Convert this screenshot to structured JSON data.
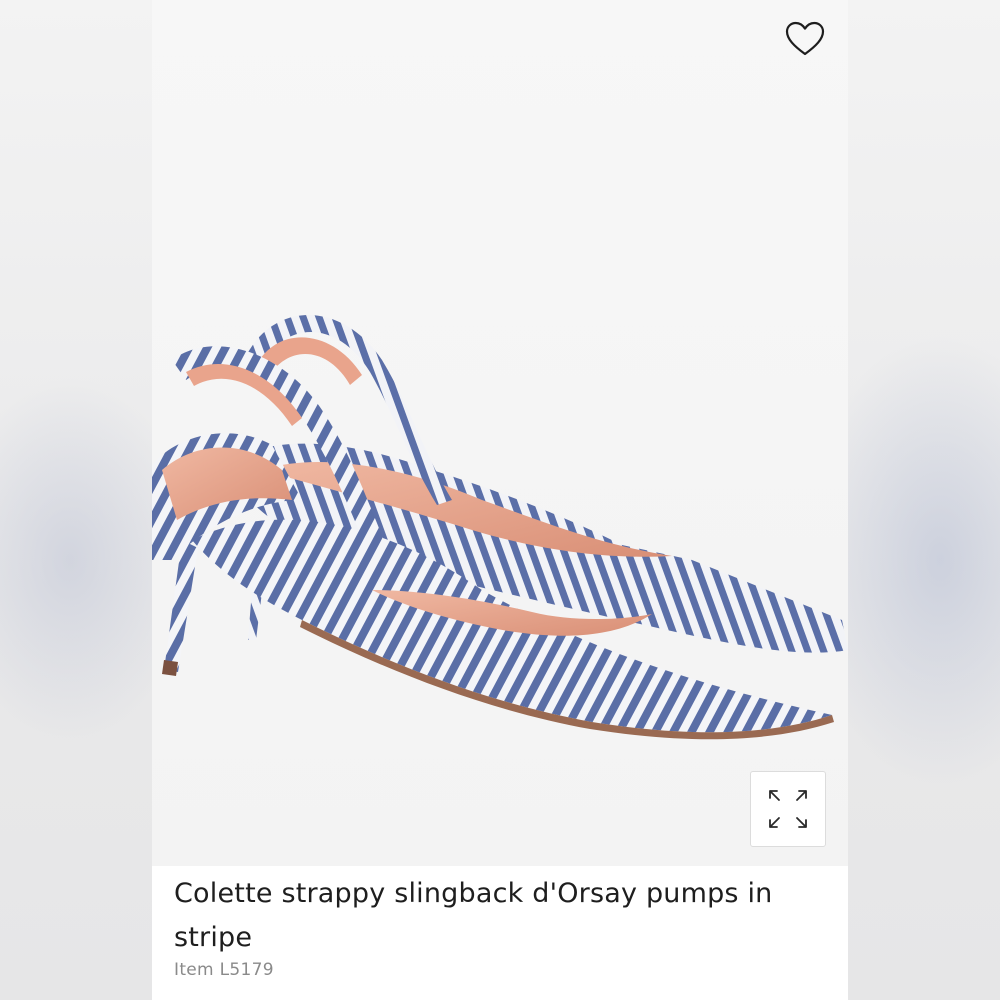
{
  "product": {
    "title": "Colette strappy slingback d'Orsay pumps in stripe",
    "item_number": "Item L5179",
    "image_alt": "Striped slingback kitten heel pumps"
  },
  "icons": {
    "favorite": "heart-icon",
    "expand": "expand-icon"
  },
  "colors": {
    "stripe_blue": "#5a6ea6",
    "stripe_white": "#f4f5f8",
    "lining": "#e6a790",
    "sole": "#9a6a52"
  }
}
